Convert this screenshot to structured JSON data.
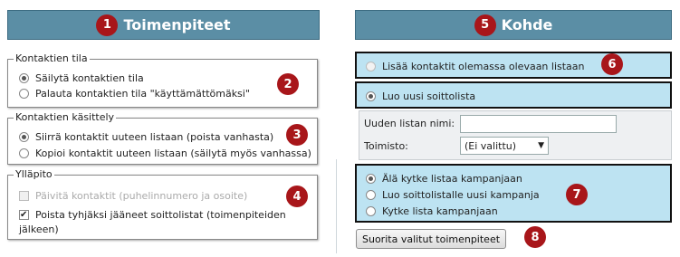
{
  "left_panel": {
    "header": {
      "badge": "1",
      "title": "Toimenpiteet"
    },
    "contact_state": {
      "legend": "Kontaktien tila",
      "badge": "2",
      "options": [
        {
          "label": "Säilytä kontaktien tila",
          "checked": true
        },
        {
          "label": "Palauta kontaktien tila \"käyttämättömäksi\"",
          "checked": false
        }
      ]
    },
    "contact_handling": {
      "legend": "Kontaktien käsittely",
      "badge": "3",
      "options": [
        {
          "label": "Siirrä kontaktit uuteen listaan (poista vanhasta)",
          "checked": true
        },
        {
          "label": "Kopioi kontaktit uuteen listaan (säilytä myös vanhassa)",
          "checked": false
        }
      ]
    },
    "maintenance": {
      "legend": "Ylläpito",
      "badge": "4",
      "options": [
        {
          "label": "Päivitä kontaktit (puhelinnumero ja osoite)",
          "checked": false,
          "disabled": true
        },
        {
          "label_line1": "Poista tyhjäksi jääneet soittolistat (toimenpiteiden",
          "label_line2": "jälkeen)",
          "checked": true,
          "disabled": false
        }
      ]
    }
  },
  "right_panel": {
    "header": {
      "badge": "5",
      "title": "Kohde"
    },
    "add_existing": {
      "label": "Lisää kontaktit olemassa olevaan listaan",
      "badge": "6",
      "checked": false
    },
    "new_list": {
      "label": "Luo uusi soittolista",
      "checked": true
    },
    "new_list_form": {
      "name_label": "Uuden listan nimi:",
      "name_value": "",
      "office_label": "Toimisto:",
      "office_value": "(Ei valittu)"
    },
    "campaign": {
      "badge": "7",
      "options": [
        {
          "label": "Älä kytke listaa kampanjaan",
          "checked": true
        },
        {
          "label": "Luo soittolistalle uusi kampanja",
          "checked": false
        },
        {
          "label": "Kytke lista kampanjaan",
          "checked": false
        }
      ]
    },
    "submit": {
      "label": "Suorita valitut toimenpiteet",
      "badge": "8"
    }
  },
  "colors": {
    "header": "#5b8ea5",
    "badge": "#a8161a",
    "highlight": "#bde3f2"
  }
}
